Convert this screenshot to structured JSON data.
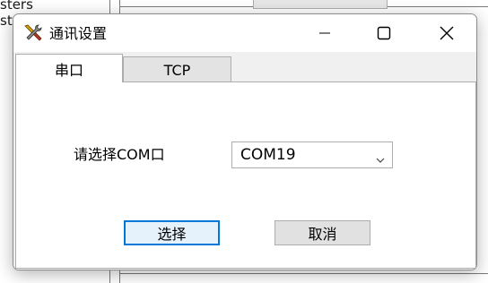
{
  "background": {
    "lines": [
      "sters",
      "st"
    ]
  },
  "dialog": {
    "title": "通讯设置",
    "icon": "tools-icon",
    "window_controls": [
      "minimize-icon",
      "maximize-icon",
      "close-icon"
    ]
  },
  "tabs": [
    {
      "label": "串口",
      "selected": true
    },
    {
      "label": "TCP",
      "selected": false
    }
  ],
  "serial": {
    "port_label": "请选择COM口",
    "port_value": "COM19"
  },
  "buttons": {
    "select": "选择",
    "cancel": "取消"
  },
  "colors": {
    "focus_border": "#0078d7",
    "button_bg": "#e1e1e1"
  }
}
